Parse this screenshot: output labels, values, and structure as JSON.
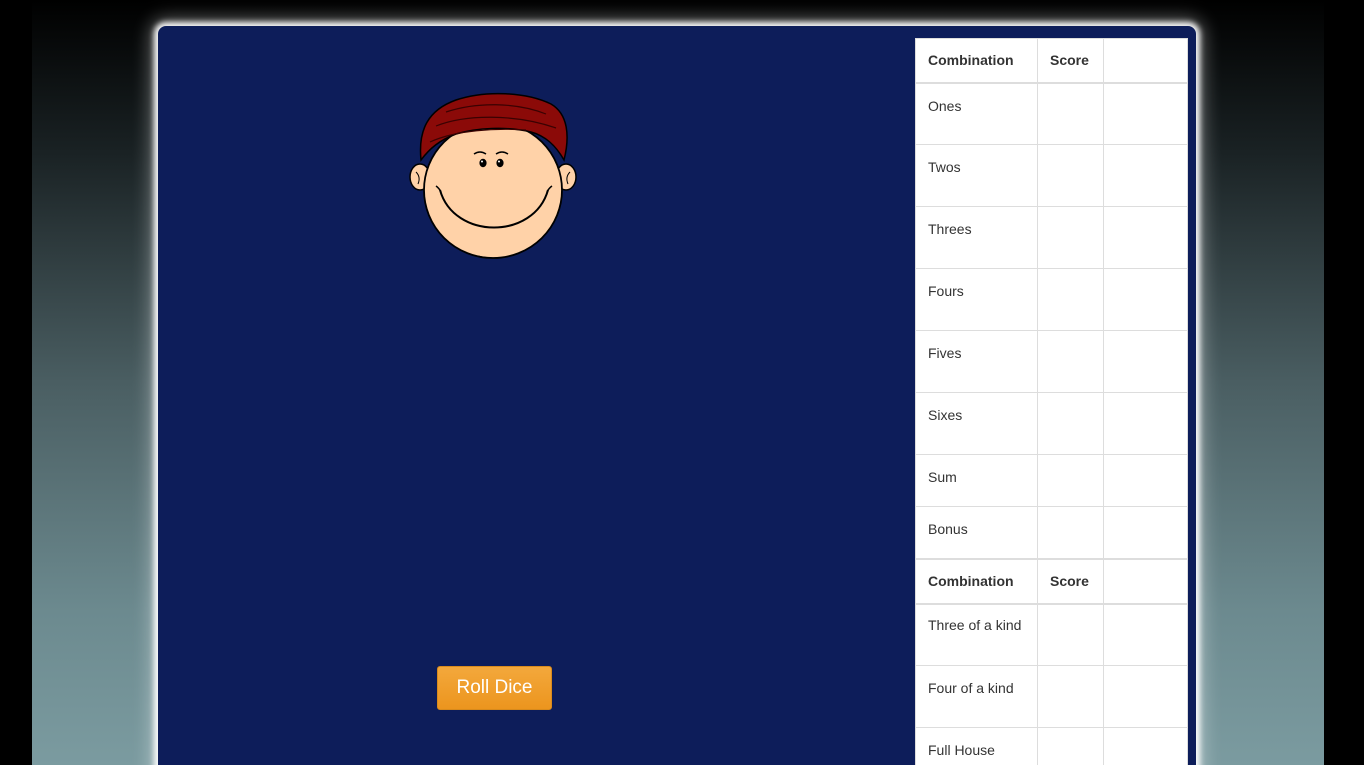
{
  "game": {
    "roll_button_label": "Roll Dice"
  },
  "upper_section": {
    "headers": {
      "combination": "Combination",
      "score": "Score"
    },
    "rows": [
      {
        "label": "Ones"
      },
      {
        "label": "Twos"
      },
      {
        "label": "Threes"
      },
      {
        "label": "Fours"
      },
      {
        "label": "Fives"
      },
      {
        "label": "Sixes"
      }
    ],
    "sum_label": "Sum",
    "bonus_label": "Bonus"
  },
  "lower_section": {
    "headers": {
      "combination": "Combination",
      "score": "Score"
    },
    "rows": [
      {
        "label": "Three of a kind"
      },
      {
        "label": "Four of a kind"
      },
      {
        "label": "Full House"
      }
    ]
  },
  "colors": {
    "board_background": "#0d1d5a",
    "button_orange": "#f0a030",
    "hair": "#8b0a08",
    "skin": "#ffd2a8"
  },
  "icons": {
    "avatar": "smiling-boy-face-icon"
  }
}
